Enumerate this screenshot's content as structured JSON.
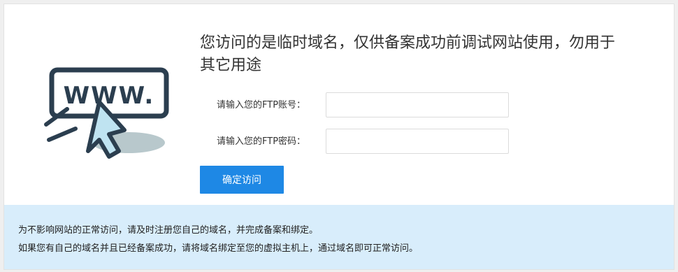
{
  "headline": "您访问的是临时域名，仅供备案成功前调试网站使用，勿用于其它用途",
  "illustration": {
    "icon": "www-browser-cursor-icon",
    "text": "WWW."
  },
  "form": {
    "account_label": "请输入您的FTP账号：",
    "account_value": "",
    "account_placeholder": "",
    "password_label": "请输入您的FTP密码：",
    "password_value": "",
    "password_placeholder": "",
    "submit_label": "确定访问"
  },
  "notice": {
    "line1": "为不影响网站的正常访问，请及时注册您自己的域名，并完成备案和绑定。",
    "line2": "如果您有自己的域名并且已经备案成功，请将域名绑定至您的虚拟主机上，通过域名即可正常访问。"
  },
  "colors": {
    "accent": "#1e88e5",
    "notice_bg": "#d8edfb",
    "icon_dark": "#2b3e4f",
    "icon_cursor": "#bfe3f1",
    "icon_shadow": "#b8c8cc"
  }
}
